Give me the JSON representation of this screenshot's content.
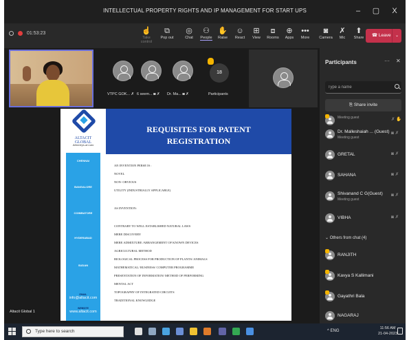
{
  "window": {
    "title": "INTELLECTUAL PROPERTY RIGHTS AND IP MANAGEMENT FOR START UPS",
    "minimize": "–",
    "maximize": "▢",
    "close": "X"
  },
  "toolbar": {
    "timer": "01:53:23",
    "items": [
      {
        "label": "Take control",
        "icon": "hand-pointer-icon",
        "enabled": false
      },
      {
        "label": "Pop out",
        "icon": "pop-out-icon",
        "enabled": true
      },
      {
        "label": "Chat",
        "icon": "chat-icon",
        "enabled": true
      },
      {
        "label": "People",
        "icon": "people-icon",
        "enabled": true,
        "active": true
      },
      {
        "label": "Raise",
        "icon": "raise-hand-icon",
        "enabled": true
      },
      {
        "label": "React",
        "icon": "react-icon",
        "enabled": true
      },
      {
        "label": "View",
        "icon": "view-icon",
        "enabled": true
      },
      {
        "label": "Rooms",
        "icon": "rooms-icon",
        "enabled": true
      },
      {
        "label": "Apps",
        "icon": "apps-icon",
        "enabled": true
      },
      {
        "label": "More",
        "icon": "more-icon",
        "enabled": true
      },
      {
        "label": "Camera",
        "icon": "camera-off-icon",
        "enabled": true
      },
      {
        "label": "Mic",
        "icon": "mic-off-icon",
        "enabled": true
      },
      {
        "label": "Share",
        "icon": "share-icon",
        "enabled": true
      }
    ],
    "leave_label": "Leave",
    "people_badge": "3"
  },
  "stage": {
    "participant_tiles": [
      {
        "label": "VTPC GOK...",
        "icon": "avatar-icon"
      },
      {
        "label": "6 seem...",
        "icon": "avatar-icon"
      },
      {
        "label": "Dr. Ma...",
        "icon": "avatar-icon"
      }
    ],
    "participants_count": "18",
    "participants_label": "Participants",
    "presenter_name": "Altacit Global 1"
  },
  "slide": {
    "logo_name": "ALTACIT GLOBAL",
    "logo_tagline": "Attorneys-at-Law",
    "offices": [
      {
        "city": "CHENNAI"
      },
      {
        "city": "BANGALORE"
      },
      {
        "city": "COIMBATORE"
      },
      {
        "city": "HYDERABAD"
      },
      {
        "city": "SUDAN"
      }
    ],
    "email_label": "EMAIL",
    "email": "info@altacit.com",
    "website_label": "WEBSITE",
    "website": "www.altacit.com",
    "title_line1": "REQUISITES FOR PATENT",
    "title_line2": "REGISTRATION",
    "lines": [
      "AN INVENTION PERSE IS :",
      "NOVEL",
      "NON- OBVIOUS",
      "UTILITY (INDUSTRIALLY APPLICABLE)",
      "AS INVENTION:",
      "CONTRARY TO WELL ESTABLISHED NATURAL LAWS",
      "MERE DISCOVERY",
      "MERE ADMIXTURE /ARRANGEMENT OF KNOWN DEVICES",
      "AGRICULTURAL METHOD",
      "BIOLOGICAL PROCESS FOR PRODUCTION OF PLANTS/ ANIMALS",
      "MATHEMATICAL/ BUSINESS/ COMPUTER PROGRAMME",
      "PRESENTATION OF INFORMATION/ METHOD OF PERFORMING",
      "MENTAL ACT",
      "TOPOGRAPHY OF INTEGRATED CIRCUITS",
      "TRADITIONAL KNOWLEDGE"
    ]
  },
  "panel": {
    "title": "Participants",
    "search_placeholder": "Type a name",
    "share_invite": "Share invite",
    "section_other": "Others from chat (4)",
    "participants": [
      {
        "name": "",
        "sub": "Meeting guest",
        "hand": true
      },
      {
        "name": "Dr. Malleshaiah ... (Guest)",
        "sub": "Meeting guest",
        "hand": false
      },
      {
        "name": "GRETAL",
        "sub": "",
        "hand": false
      },
      {
        "name": "SAHANA",
        "sub": "",
        "hand": false
      },
      {
        "name": "Shivanand C G(Guest)",
        "sub": "Meeting guest",
        "hand": false
      },
      {
        "name": "VIBHA",
        "sub": "",
        "hand": false
      }
    ],
    "others": [
      {
        "name": "RANJITH",
        "hand": true
      },
      {
        "name": "Kavya S Kallimani",
        "hand": true
      },
      {
        "name": "Gayathri Bala",
        "hand": true
      },
      {
        "name": "NAGARAJ",
        "hand": false
      }
    ]
  },
  "taskbar": {
    "search_placeholder": "Type here to search",
    "tray_text": "^ ENG",
    "time": "11:56 AM",
    "date": "21-04-2023"
  },
  "colors": {
    "accent": "#6a6fdc",
    "leave": "#c4314b",
    "slide_blue": "#1f4aa8",
    "slide_side": "#2aa2e6"
  }
}
